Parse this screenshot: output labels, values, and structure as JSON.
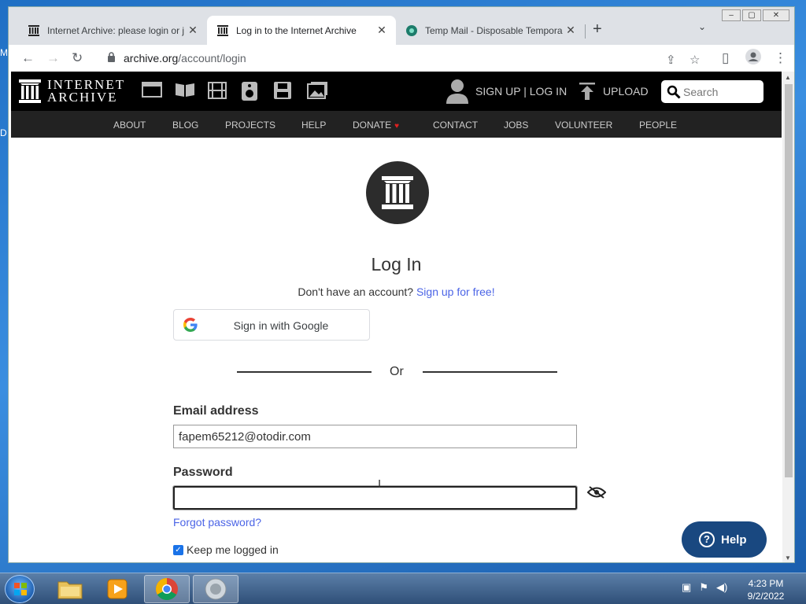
{
  "desktop": {
    "frag_top": "M",
    "frag_bottom": "D"
  },
  "window": {
    "min": "–",
    "max": "▢",
    "close": "✕"
  },
  "tabs": [
    {
      "title": "Internet Archive: please login or j",
      "close": "✕"
    },
    {
      "title": "Log in to the Internet Archive",
      "close": "✕"
    },
    {
      "title": "Temp Mail - Disposable Tempora",
      "close": "✕"
    }
  ],
  "newtab": "+",
  "tabsearch": "⌄",
  "toolbar": {
    "back": "←",
    "forward": "→",
    "reload": "↻",
    "url_host": "archive.org",
    "url_path": "/account/login",
    "share": "⇪",
    "star": "☆",
    "sidepanel": "▯",
    "menu": "⋮"
  },
  "ia": {
    "logo_line1": "INTERNET",
    "logo_line2": "ARCHIVE",
    "signup_login": "SIGN UP | LOG IN",
    "upload": "UPLOAD",
    "search_placeholder": "Search",
    "nav": [
      "ABOUT",
      "BLOG",
      "PROJECTS",
      "HELP",
      "DONATE",
      "CONTACT",
      "JOBS",
      "VOLUNTEER",
      "PEOPLE"
    ],
    "heart": "♥"
  },
  "login": {
    "title": "Log In",
    "no_account": "Don't have an account?",
    "signup_link": "Sign up for free!",
    "google_label": "Sign in with Google",
    "or": "Or",
    "email_label": "Email address",
    "email_value": "fapem65212@otodir.com",
    "password_label": "Password",
    "password_value": "",
    "forgot": "Forgot password?",
    "keep": "Keep me logged in",
    "help": "Help"
  },
  "taskbar": {
    "time": "4:23 PM",
    "date": "9/2/2022"
  }
}
